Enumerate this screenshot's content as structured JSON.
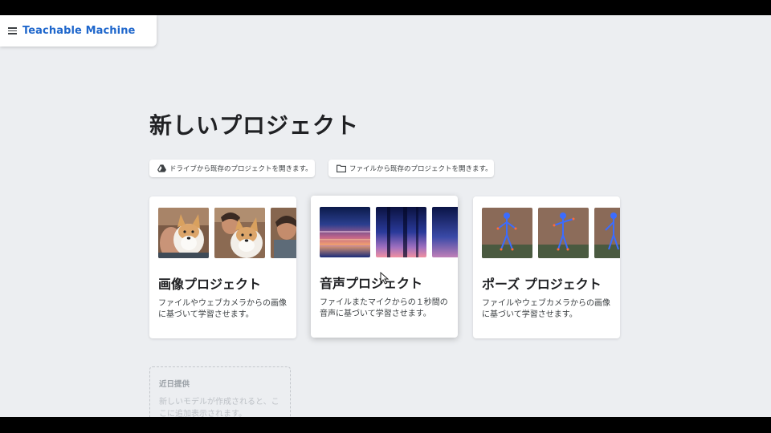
{
  "app": {
    "title": "Teachable Machine"
  },
  "page": {
    "title": "新しいプロジェクト"
  },
  "open_buttons": {
    "drive_label": "ドライブから既存のプロジェクトを開きます。",
    "file_label": "ファイルから既存のプロジェクトを開きます。",
    "drive_icon": "google-drive-icon",
    "file_icon": "folder-icon"
  },
  "projects": [
    {
      "title": "画像プロジェクト",
      "description": "ファイルやウェブカメラからの画像に基づいて学習させます。"
    },
    {
      "title": "音声プロジェクト",
      "description": "ファイルまたマイクからの１秒間の音声に基づいて学習させます。"
    },
    {
      "title": "ポーズ プロジェクト",
      "description": "ファイルやウェブカメラからの画像に基づいて学習させます。"
    }
  ],
  "coming_soon": {
    "title": "近日提供",
    "description": "新しいモデルが作成されると、ここに追加表示されます。"
  },
  "colors": {
    "brand_blue": "#1f67cc",
    "page_background": "#eceef1",
    "card_background": "#ffffff"
  }
}
